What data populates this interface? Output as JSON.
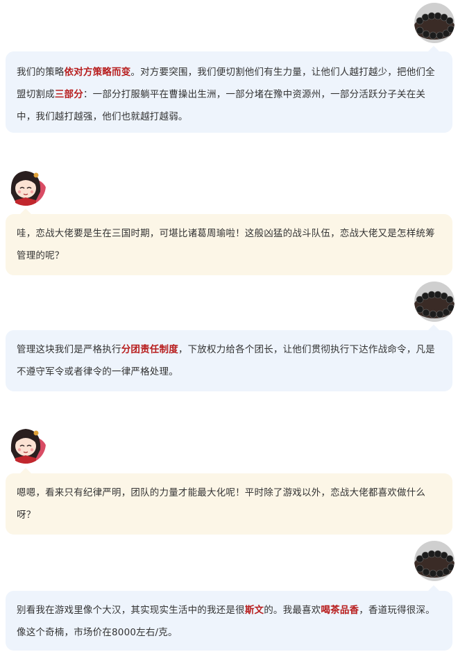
{
  "accent": "#b71c1c",
  "colors": {
    "bubble_blue": "#eef4fc",
    "bubble_cream": "#fcf6e7"
  },
  "avatars": {
    "interviewee": "prayer-beads-bracelet-photo",
    "host": "cartoon-girl-mascot"
  },
  "messages": [
    {
      "speaker": "interviewee",
      "segments": [
        {
          "t": "我们的策略"
        },
        {
          "t": "依对方策略而变",
          "hl": true
        },
        {
          "t": "。对方要突围，我们便切割他们有生力量，让他们人越打越少，把他们全盟切割成"
        },
        {
          "t": "三部分",
          "hl": true
        },
        {
          "t": "：一部分打服躺平在曹操出生洲，一部分堵在豫中资源州，一部分活跃分子关在关中，我们越打越强，他们也就越打越弱。"
        }
      ]
    },
    {
      "speaker": "host",
      "segments": [
        {
          "t": "哇，恋战大佬要是生在三国时期，可堪比诸葛周瑜啦！这般凶猛的战斗队伍，恋战大佬又是怎样统筹管理的呢？"
        }
      ]
    },
    {
      "speaker": "interviewee",
      "segments": [
        {
          "t": "管理这块我们是严格执行"
        },
        {
          "t": "分团责任制度",
          "hl": true
        },
        {
          "t": "，下放权力给各个团长，让他们贯彻执行下达作战命令，凡是不遵守军令或者律令的一律严格处理。"
        }
      ]
    },
    {
      "speaker": "host",
      "segments": [
        {
          "t": "嗯嗯，看来只有纪律严明，团队的力量才能最大化呢！平时除了游戏以外，恋战大佬都喜欢做什么呀？"
        }
      ]
    },
    {
      "speaker": "interviewee",
      "segments": [
        {
          "t": "别看我在游戏里像个大汉，其实现实生活中的我还是很"
        },
        {
          "t": "斯文",
          "hl": true
        },
        {
          "t": "的。我最喜欢"
        },
        {
          "t": "喝茶品香",
          "hl": true
        },
        {
          "t": "，香道玩得很深。像这个奇楠，市场价在8000左右/克。"
        }
      ]
    }
  ]
}
